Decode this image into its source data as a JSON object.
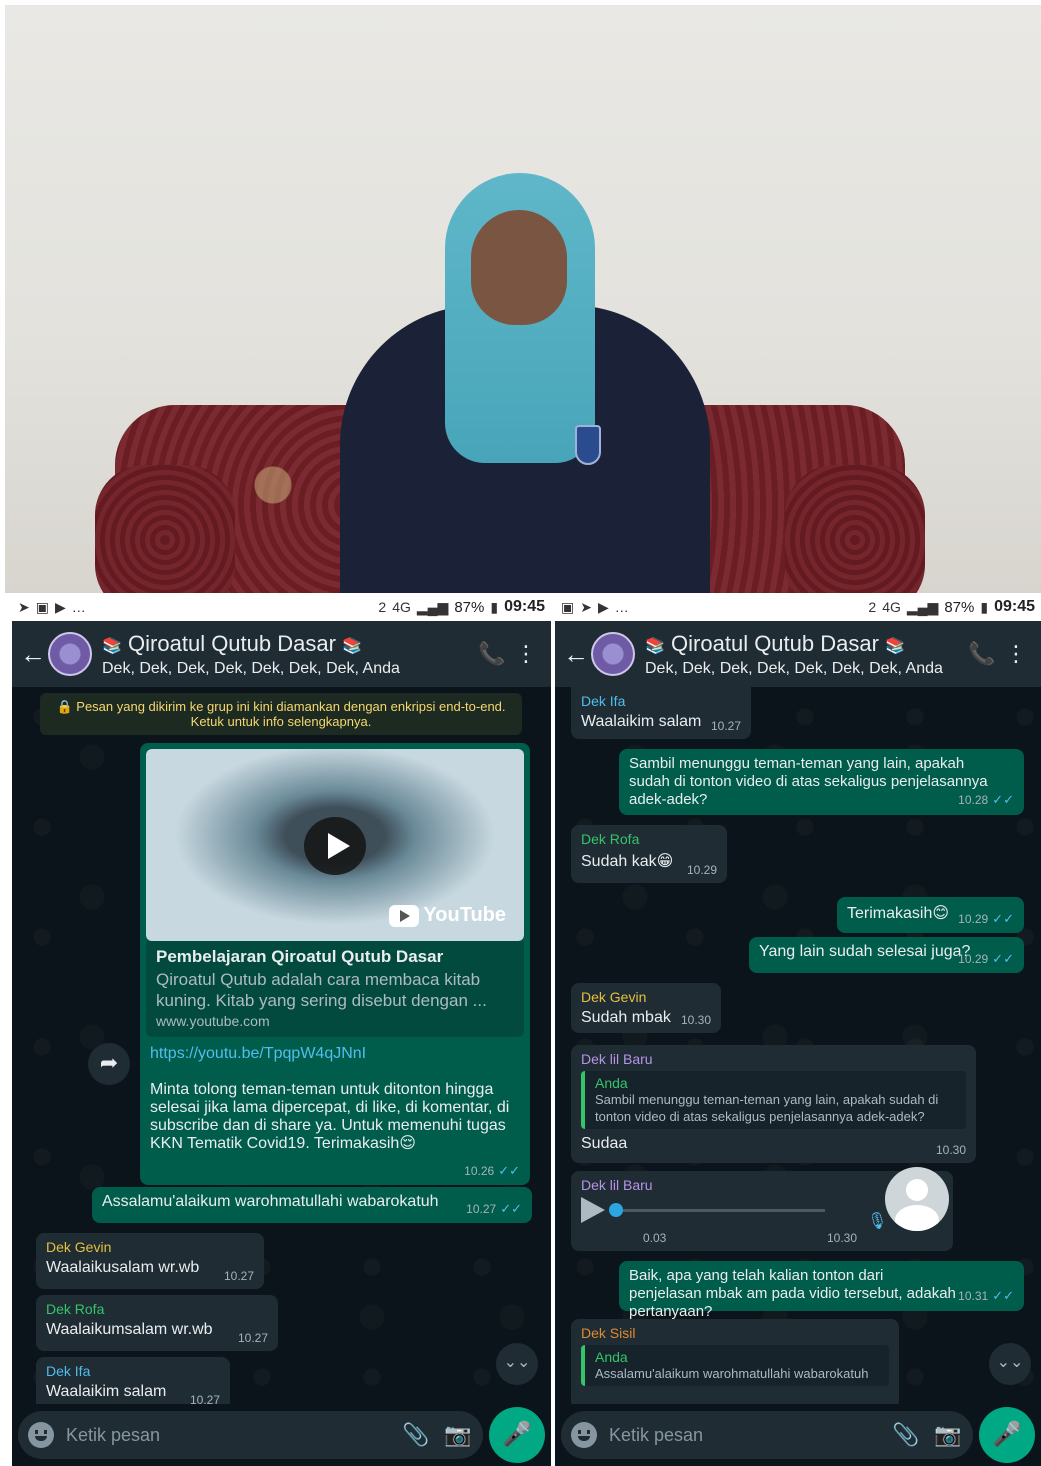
{
  "status_left": {
    "time": "09:45",
    "battery": "87%",
    "sim": "2",
    "net": "4G"
  },
  "status_right": {
    "time": "09:45",
    "battery": "87%",
    "sim": "2",
    "net": "4G"
  },
  "header": {
    "title": "Qiroatul Qutub Dasar",
    "members": "Dek, Dek, Dek, Dek, Dek, Dek, Dek, Anda"
  },
  "left_chat": {
    "encryption_note": "🔒 Pesan yang dikirim ke grup ini kini diamankan dengan enkripsi end-to-end. Ketuk untuk info selengkapnya.",
    "video_msg": {
      "yt_brand": "YouTube",
      "preview_title": "Pembelajaran Qiroatul Qutub Dasar",
      "preview_desc": "Qiroatul Qutub adalah cara membaca kitab kuning. Kitab yang sering disebut dengan ...",
      "preview_domain": "www.youtube.com",
      "link": "https://youtu.be/TpqpW4qJNnI",
      "body": "Minta tolong teman-teman untuk ditonton hingga selesai jika lama dipercepat, di like, di komentar, di subscribe dan di share ya. Untuk memenuhi tugas KKN Tematik Covid19. Terimakasih😌",
      "time": "10.26"
    },
    "salam": {
      "text": "Assalamu'alaikum warohmatullahi wabarokatuh",
      "time": "10.27"
    },
    "reply_gevin": {
      "sender": "Dek Gevin",
      "text": "Waalaikusalam wr.wb",
      "time": "10.27"
    },
    "reply_rofa": {
      "sender": "Dek Rofa",
      "text": "Waalaikumsalam wr.wb",
      "time": "10.27"
    },
    "reply_ifa": {
      "sender": "Dek Ifa",
      "text": "Waalaikim salam",
      "time": "10.27"
    }
  },
  "right_chat": {
    "m1": {
      "sender": "Dek Ifa",
      "text": "Waalaikim salam",
      "time": "10.27"
    },
    "m2": {
      "text": "Sambil menunggu teman-teman yang lain, apakah sudah di tonton video di atas sekaligus penjelasannya adek-adek?",
      "time": "10.28"
    },
    "m3": {
      "sender": "Dek Rofa",
      "text": "Sudah kak😁",
      "time": "10.29"
    },
    "m4": {
      "text": "Terimakasih😊",
      "time": "10.29"
    },
    "m5": {
      "text": "Yang lain sudah selesai juga?",
      "time": "10.29"
    },
    "m6": {
      "sender": "Dek Gevin",
      "text": "Sudah mbak",
      "time": "10.30"
    },
    "m7": {
      "sender": "Dek lil Baru",
      "quote_name": "Anda",
      "quote_text": "Sambil menunggu teman-teman yang lain, apakah sudah di tonton video di atas sekaligus penjelasannya adek-adek?",
      "text": "Sudaa",
      "time": "10.30"
    },
    "m8": {
      "sender": "Dek lil Baru",
      "duration": "0.03",
      "time": "10.30",
      "progress": 0
    },
    "m9": {
      "text": "Baik, apa yang telah kalian tonton dari penjelasan mbak am pada vidio tersebut, adakah pertanyaan?",
      "time": "10.31"
    },
    "m10": {
      "sender": "Dek Sisil",
      "quote_name": "Anda",
      "quote_text": "Assalamu'alaikum warohmatullahi wabarokatuh"
    }
  },
  "input": {
    "placeholder": "Ketik pesan"
  },
  "colors": {
    "outgoing": "#005c4b",
    "incoming": "#1f2c34",
    "accent": "#00a884",
    "ticks": "#53bdeb"
  }
}
